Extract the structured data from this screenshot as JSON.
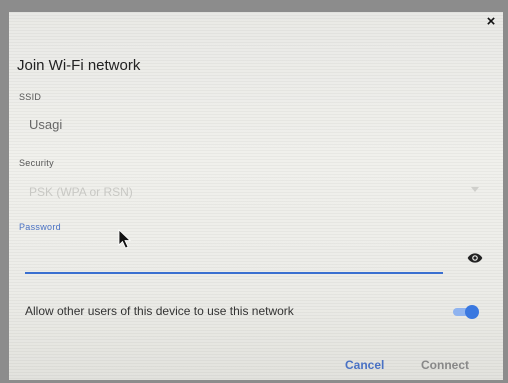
{
  "dialog": {
    "close_glyph": "×",
    "title": "Join Wi-Fi network",
    "ssid": {
      "label": "SSID",
      "value": "Usagi"
    },
    "security": {
      "label": "Security",
      "selected": "PSK (WPA or RSN)"
    },
    "password": {
      "label": "Password",
      "value": ""
    },
    "allow_all": {
      "label": "Allow other users of this device to use this network",
      "enabled": true
    },
    "buttons": {
      "cancel": "Cancel",
      "connect": "Connect"
    }
  },
  "colors": {
    "accent": "#3a6fd0",
    "toggle_on": "#3a78e0",
    "disabled_text": "#c8c8c4"
  },
  "icons": [
    "close-icon",
    "eye-icon",
    "dropdown-arrow-icon",
    "mouse-pointer-icon"
  ]
}
